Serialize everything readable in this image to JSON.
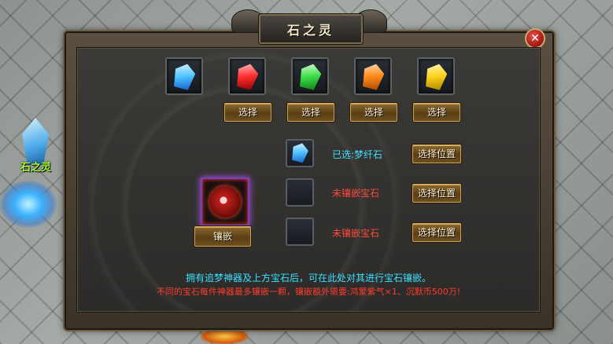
{
  "npc": {
    "name": "石之灵"
  },
  "window": {
    "title": "石之灵",
    "close_symbol": "✕"
  },
  "gems": [
    {
      "color": "blue",
      "icon": "blue-gem-icon"
    },
    {
      "color": "red",
      "icon": "red-gem-icon",
      "button": "选择"
    },
    {
      "color": "green",
      "icon": "green-gem-icon",
      "button": "选择"
    },
    {
      "color": "orange",
      "icon": "orange-gem-icon",
      "button": "选择"
    },
    {
      "color": "yellow",
      "icon": "yellow-gem-icon",
      "button": "选择"
    }
  ],
  "target": {
    "icon": "divine-artifact-icon",
    "inlay_button": "镶嵌"
  },
  "sockets": [
    {
      "filled": true,
      "gem": "blue",
      "status": "已选:梦纤石",
      "button": "选择位置"
    },
    {
      "filled": false,
      "status": "未镶嵌宝石",
      "button": "选择位置"
    },
    {
      "filled": false,
      "status": "未镶嵌宝石",
      "button": "选择位置"
    }
  ],
  "description": {
    "line1": "拥有追梦神器及上方宝石后，可在此处对其进行宝石镶嵌。",
    "line2": "不同的宝石每件神器最多镶嵌一颗，镶嵌额外需要:鸿蒙紫气×1、沉默币500万!"
  },
  "colors": {
    "cyan_text": "#39e0ff",
    "red_text": "#ff3b2b",
    "button_gold": "#c9a45a"
  }
}
